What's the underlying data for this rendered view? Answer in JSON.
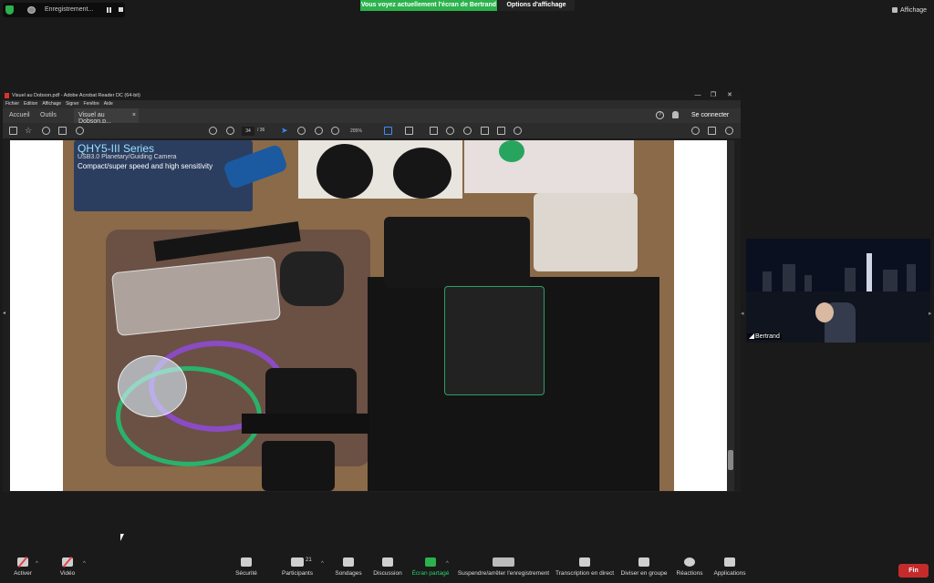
{
  "recording": {
    "label": "Enregistrement..."
  },
  "banner": {
    "share_text": "Vous voyez actuellement l'écran de Bertrand",
    "view_options": "Options d'affichage"
  },
  "display": {
    "label": "Affichage"
  },
  "acrobat": {
    "title": "Visuel au Dobson.pdf - Adobe Acrobat Reader DC (64-bit)",
    "menu": [
      "Fichier",
      "Edition",
      "Affichage",
      "Signer",
      "Fenêtre",
      "Aide"
    ],
    "tabs": {
      "home": "Accueil",
      "tools": "Outils",
      "doc": "Visuel au Dobson.p...",
      "close": "×"
    },
    "connect": "Se connecter",
    "page_current": "34",
    "page_total": "/ 36",
    "zoom": "205%",
    "window_controls": [
      "—",
      "❐",
      "✕"
    ]
  },
  "photo": {
    "poster_line1": "QHY5-III Series",
    "poster_line2": "USB3.0 Planetary/Guiding Camera",
    "poster_line3": "Compact/super speed and high sensitivity"
  },
  "video": {
    "participant_name": "Bertrand"
  },
  "toolbar": {
    "mute": "Activer",
    "video": "Vidéo",
    "security": "Sécurité",
    "participants": "Participants",
    "participants_count": "21",
    "polls": "Sondages",
    "chat": "Discussion",
    "share": "Écran partagé",
    "recording_control": "Suspendre/arrêter l'enregistrement",
    "transcription": "Transcription en direct",
    "breakout": "Diviser en groupe",
    "reactions": "Réactions",
    "apps": "Applications",
    "end": "Fin"
  },
  "colors": {
    "zoom_green": "#2bb24c",
    "end_red": "#c52b2b",
    "bg": "#1a1a1a"
  }
}
